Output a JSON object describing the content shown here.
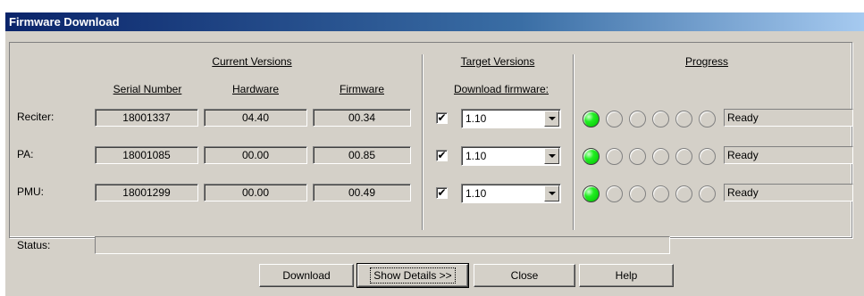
{
  "window": {
    "title": "Firmware Download"
  },
  "headers": {
    "current_versions": "Current Versions",
    "target_versions": "Target Versions",
    "progress": "Progress",
    "serial_number": "Serial Number",
    "hardware": "Hardware",
    "firmware": "Firmware",
    "download_firmware": "Download firmware:"
  },
  "rows": [
    {
      "label": "Reciter:",
      "serial": "18001337",
      "hardware": "04.40",
      "firmware": "00.34",
      "checked": true,
      "check_mark": "✔",
      "target": "1.10",
      "progress_step": 1,
      "progress_total": 6,
      "status": "Ready"
    },
    {
      "label": "PA:",
      "serial": "18001085",
      "hardware": "00.00",
      "firmware": "00.85",
      "checked": true,
      "check_mark": "✔",
      "target": "1.10",
      "progress_step": 1,
      "progress_total": 6,
      "status": "Ready"
    },
    {
      "label": "PMU:",
      "serial": "18001299",
      "hardware": "00.00",
      "firmware": "00.49",
      "checked": true,
      "check_mark": "✔",
      "target": "1.10",
      "progress_step": 1,
      "progress_total": 6,
      "status": "Ready"
    }
  ],
  "status": {
    "label": "Status:",
    "value": ""
  },
  "buttons": {
    "download": "Download",
    "show_details": "Show Details >>",
    "close": "Close",
    "help": "Help"
  },
  "colors": {
    "titlebar": "#0a246a",
    "led_on": "#22ee22",
    "face": "#d4d0c8"
  },
  "icons": {
    "led": "status-led-icon",
    "dropdown": "chevron-down-icon"
  }
}
